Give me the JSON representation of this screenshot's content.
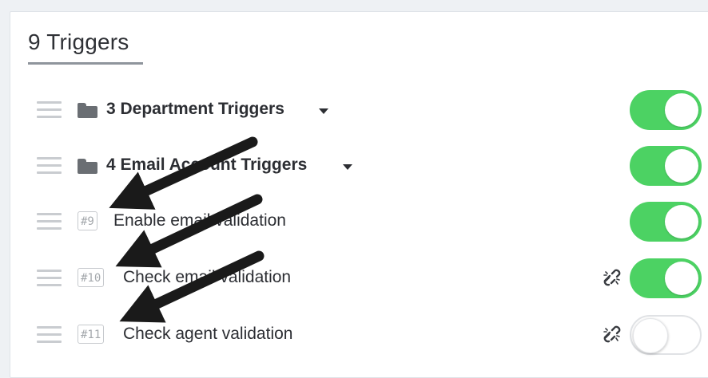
{
  "header": {
    "title": "9 Triggers"
  },
  "triggers": [
    {
      "kind": "folder",
      "label": "3 Department Triggers",
      "enabled": true,
      "linked": true
    },
    {
      "kind": "folder",
      "label": "4 Email Account Triggers",
      "enabled": true,
      "linked": true
    },
    {
      "kind": "trigger",
      "id_badge": "#9",
      "label": "Enable email validation",
      "enabled": true,
      "linked": true
    },
    {
      "kind": "trigger",
      "id_badge": "#10",
      "label": "Check email validation",
      "enabled": true,
      "linked": false
    },
    {
      "kind": "trigger",
      "id_badge": "#11",
      "label": "Check agent validation",
      "enabled": false,
      "linked": false
    }
  ],
  "icons": {
    "drag": "drag-handle-icon",
    "folder": "folder-icon",
    "caret": "chevron-down-icon",
    "unlink": "unlink-icon"
  },
  "colors": {
    "toggle_on": "#4cd263",
    "toggle_off_border": "#e0e2e5",
    "annotation_arrow": "#1a1a1a"
  }
}
